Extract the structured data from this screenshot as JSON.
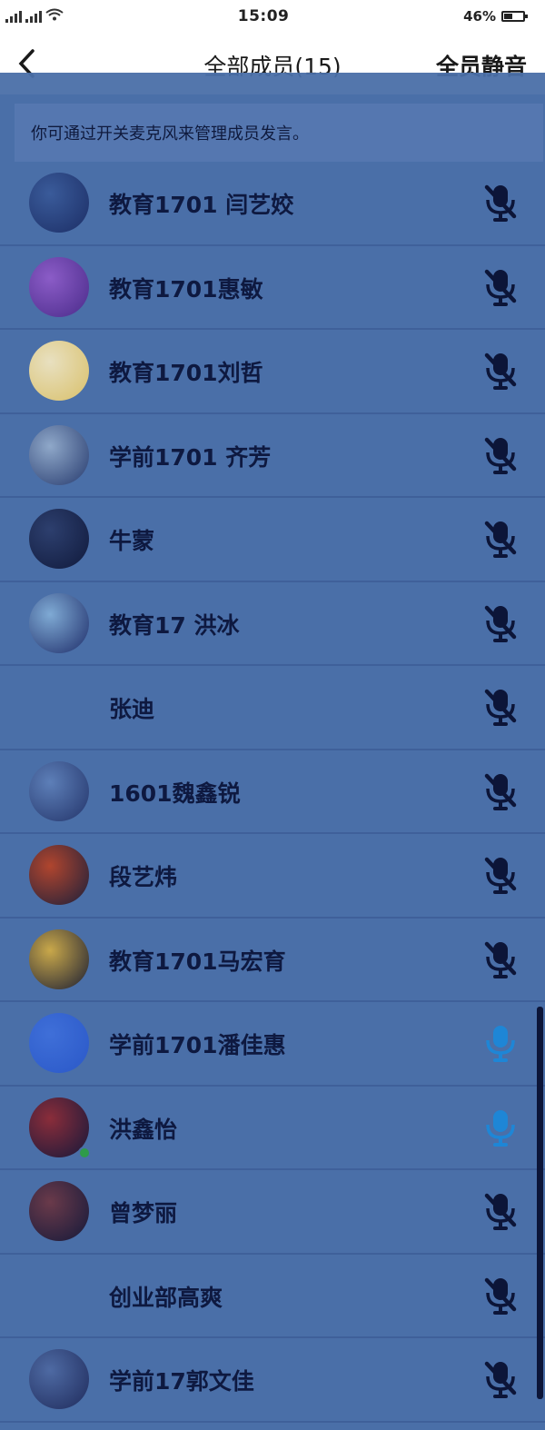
{
  "status_bar": {
    "signal_text": "4G 4G",
    "time": "15:09",
    "battery_percent": "46%",
    "battery_level": 0.46
  },
  "nav": {
    "back_icon": "chevron-left-icon",
    "title": "全部成员(15)",
    "mute_all_label": "全员静音"
  },
  "notice_text": "你可通过开关麦克风来管理成员发言。",
  "colors": {
    "background": "#4a6fa8",
    "name_text": "#0e1940",
    "mic_muted": "#0c1538",
    "mic_active": "#1e86d6"
  },
  "members": [
    {
      "name": "教育1701 闫艺姣",
      "mic": "muted",
      "avatar": [
        "#1c2e66",
        "#3a5b9a"
      ]
    },
    {
      "name": "教育1701惠敏",
      "mic": "muted",
      "avatar": [
        "#4a2b8a",
        "#8b5cc7"
      ]
    },
    {
      "name": "教育1701刘哲",
      "mic": "muted",
      "avatar": [
        "#d9c06a",
        "#e8e0c0"
      ]
    },
    {
      "name": "学前1701 齐芳",
      "mic": "muted",
      "avatar": [
        "#263a6e",
        "#8fa8c9"
      ]
    },
    {
      "name": "牛蒙",
      "mic": "muted",
      "avatar": [
        "#101a3c",
        "#2d3f6e"
      ]
    },
    {
      "name": "教育17  洪冰",
      "mic": "muted",
      "avatar": [
        "#1e2d6a",
        "#7faad4"
      ]
    },
    {
      "name": "张迪",
      "mic": "muted",
      "avatar": [
        "#4a6fa8",
        "#4a6fa8"
      ]
    },
    {
      "name": "1601魏鑫锐",
      "mic": "muted",
      "avatar": [
        "#23346a",
        "#5d7fb8"
      ]
    },
    {
      "name": "段艺炜",
      "mic": "muted",
      "avatar": [
        "#1b1f3a",
        "#b0452e"
      ]
    },
    {
      "name": "教育1701马宏育",
      "mic": "muted",
      "avatar": [
        "#1a1d33",
        "#c9a84a"
      ]
    },
    {
      "name": "学前1701潘佳惠",
      "mic": "active",
      "avatar": [
        "#2a58c8",
        "#3f6fd8"
      ]
    },
    {
      "name": "洪鑫怡",
      "mic": "active",
      "avatar": [
        "#15183a",
        "#8a2d3a"
      ]
    },
    {
      "name": "曾梦丽",
      "mic": "muted",
      "avatar": [
        "#14193a",
        "#6a3a4a"
      ]
    },
    {
      "name": "创业部高爽",
      "mic": "muted",
      "avatar": [
        "#4a6fa8",
        "#4a6fa8"
      ]
    },
    {
      "name": "学前17郭文佳",
      "mic": "muted",
      "avatar": [
        "#1f2b5c",
        "#4e6aa3"
      ]
    }
  ]
}
